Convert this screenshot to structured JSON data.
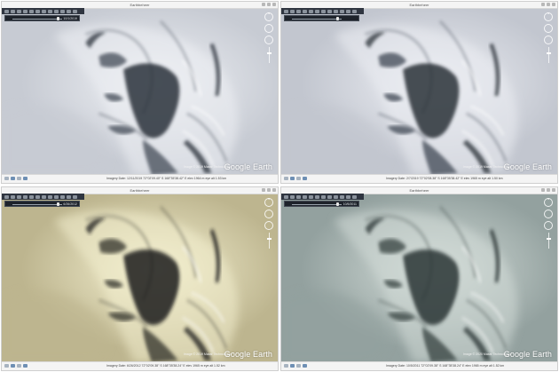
{
  "panels": [
    {
      "window_title": "Earthbeheer",
      "timeline_date": "10/1/2019",
      "imagery_credit": "Image © 2019 Maxar Technologies",
      "logo_word1": "Google",
      "logo_word2": "Earth",
      "status": "Imagery Date: 12/11/2019    72°02'09.40\" S  168°35'38.42\" E  elev  1964 m     eye alt  1.53 km",
      "palette": {
        "base": "#c7cbd3",
        "light": "#eef0f4",
        "shadow": "#4d5460",
        "deep": "#2c323b"
      }
    },
    {
      "window_title": "Earthbeheer",
      "timeline_date": "",
      "imagery_credit": "Image © 2019 Maxar Technologies",
      "logo_word1": "Google",
      "logo_word2": "Earth",
      "status": "Imagery Date: 2/7/2019    72°02'08.38\" S  168°35'38.42\" E  elev  1965 m     eye alt  1.50 km",
      "palette": {
        "base": "#c2c6cf",
        "light": "#eceef3",
        "shadow": "#4a515d",
        "deep": "#2a3039"
      }
    },
    {
      "window_title": "Earthbeheer",
      "timeline_date": "6/26/2012",
      "imagery_credit": "Image © 2019 Maxar Technologies",
      "logo_word1": "Google",
      "logo_word2": "Earth",
      "status": "Imagery Date: 6/26/2012    72°02'09.38\" S  168°35'38.24\" E  elev  1965 m     eye alt  1.52 km",
      "palette": {
        "base": "#bdb58f",
        "light": "#f3efcf",
        "shadow": "#3b3a33",
        "deep": "#1c1c1a"
      }
    },
    {
      "window_title": "Earthbeheer",
      "timeline_date": "10/5/2011",
      "imagery_credit": "Image © 2020 Maxar Technologies",
      "logo_word1": "Google",
      "logo_word2": "Earth",
      "status": "Imagery Date: 10/5/2011    72°02'09.38\" S  168°35'38.24\" E  elev  1965 m     eye alt  1.52 km",
      "palette": {
        "base": "#93a19f",
        "light": "#d3dcd8",
        "shadow": "#3d4847",
        "deep": "#2a3434"
      }
    }
  ],
  "nav": {
    "north_label": "N",
    "compass_icon": "compass-icon",
    "zoom_icon": "zoom-slider-icon"
  }
}
